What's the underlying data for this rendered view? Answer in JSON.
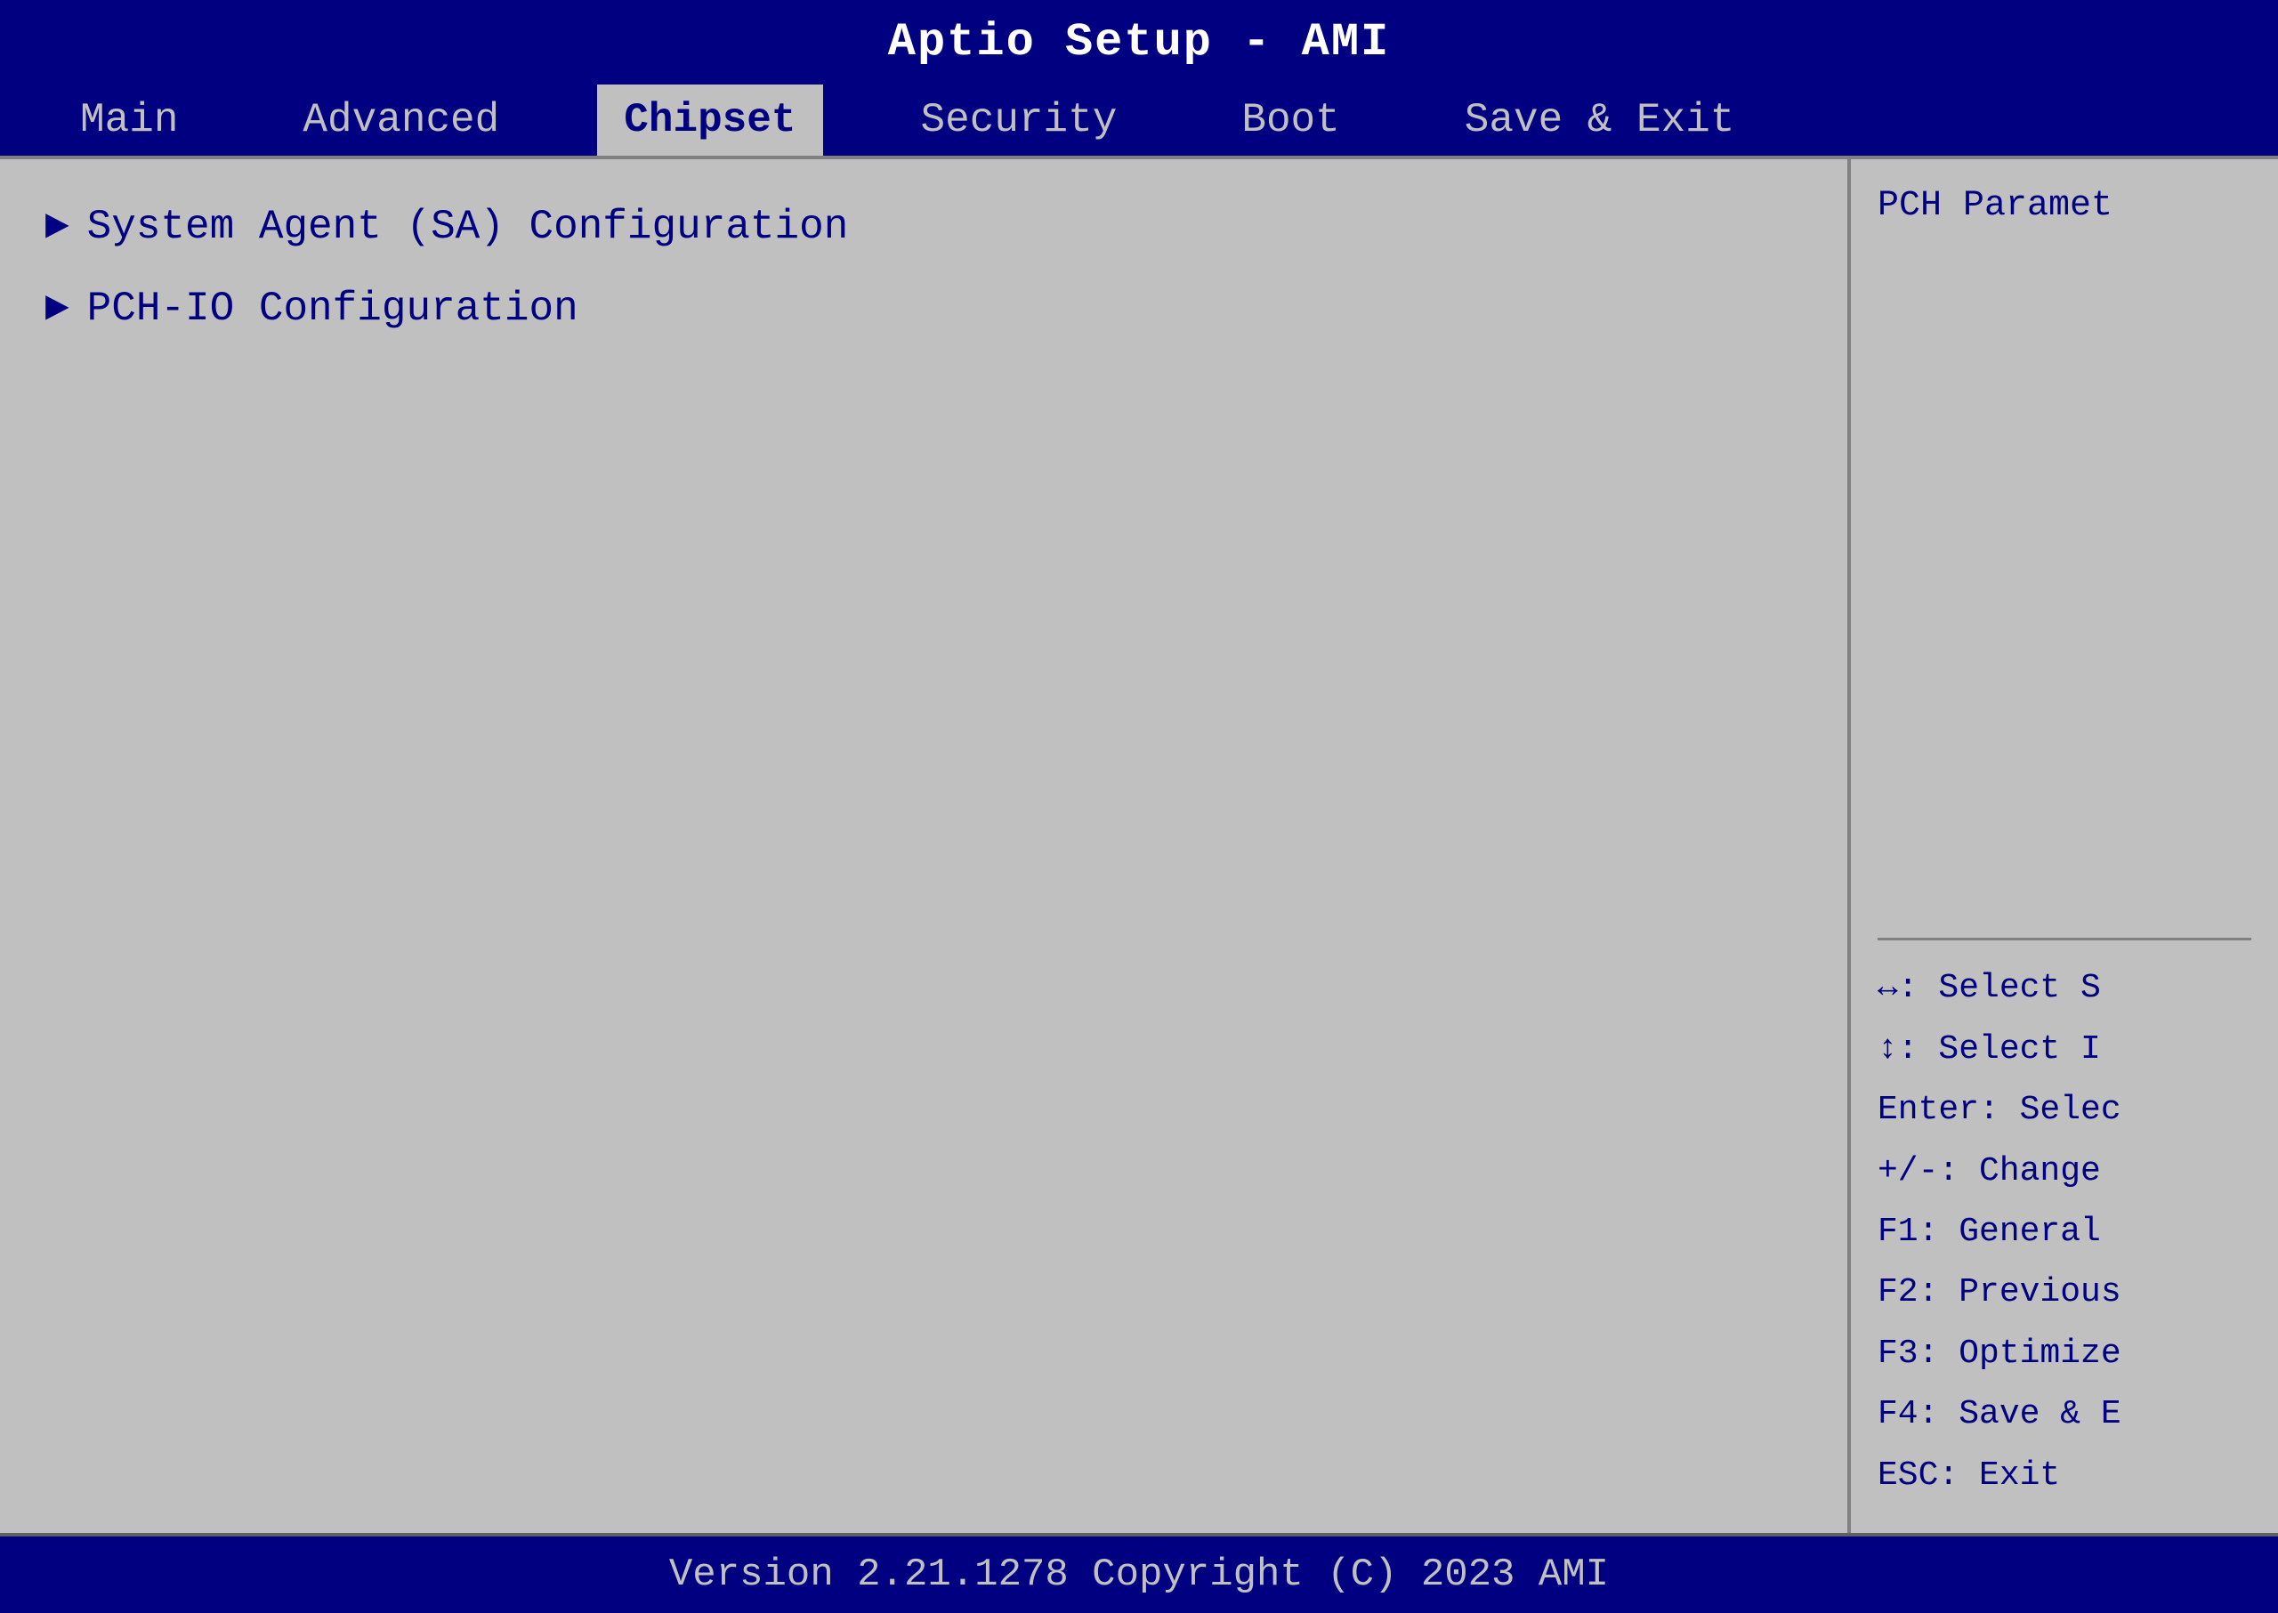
{
  "title": "Aptio Setup - AMI",
  "nav": {
    "tabs": [
      {
        "label": "Main",
        "active": false
      },
      {
        "label": "Advanced",
        "active": false
      },
      {
        "label": "Chipset",
        "active": true
      },
      {
        "label": "Security",
        "active": false
      },
      {
        "label": "Boot",
        "active": false
      },
      {
        "label": "Save & Exit",
        "active": false
      }
    ]
  },
  "left_panel": {
    "items": [
      {
        "label": "System Agent (SA) Configuration",
        "selected": false
      },
      {
        "label": "PCH-IO Configuration",
        "selected": false
      }
    ]
  },
  "right_panel": {
    "help_title": "PCH Paramet",
    "keys": [
      "↔: Select S",
      "↕: Select I",
      "Enter: Selec",
      "+/-: Change",
      "F1: General",
      "F2: Previous",
      "F3: Optimize",
      "F4: Save & E",
      "ESC: Exit"
    ]
  },
  "footer": {
    "text": "Version 2.21.1278 Copyright (C) 2023 AMI"
  }
}
